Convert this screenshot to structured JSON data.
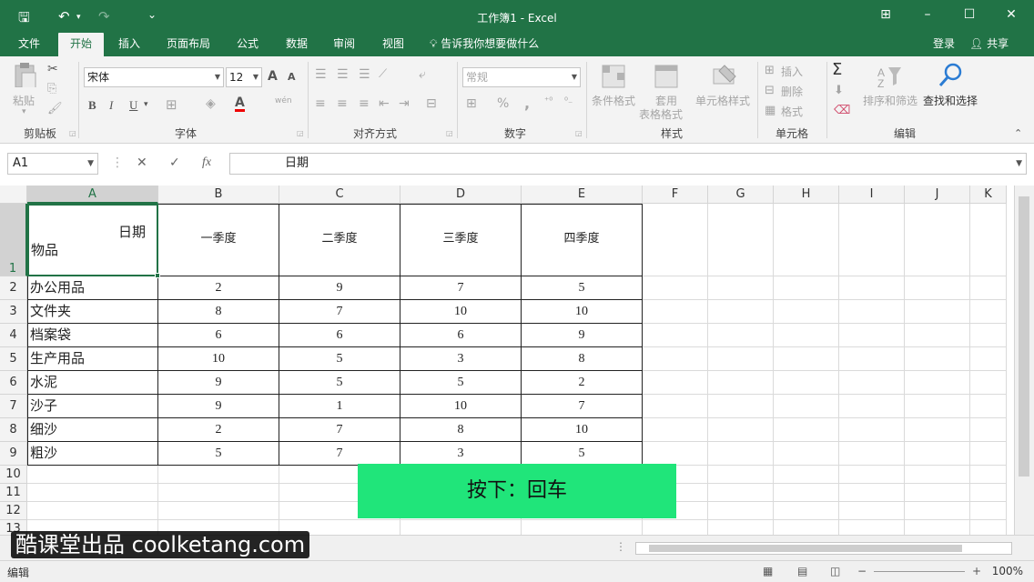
{
  "window": {
    "title": "工作簿1 - Excel",
    "min": "–",
    "max": "☐",
    "close": "✕",
    "ribbon_opts": "⊞"
  },
  "quick_access": {
    "save": "🖫",
    "undo": "↶",
    "redo": "↷",
    "more": "⌄"
  },
  "tabs": [
    "文件",
    "开始",
    "插入",
    "页面布局",
    "公式",
    "数据",
    "审阅",
    "视图"
  ],
  "active_tab": "开始",
  "tellme": "告诉我你想要做什么",
  "account": {
    "login": "登录",
    "share": "共享"
  },
  "ribbon": {
    "clipboard": {
      "paste": "粘贴",
      "label": "剪贴板"
    },
    "font": {
      "name": "宋体",
      "size": "12",
      "bold": "B",
      "italic": "I",
      "underline": "U",
      "grow": "A",
      "shrink": "A",
      "wen": "wén",
      "label": "字体"
    },
    "align": {
      "label": "对齐方式"
    },
    "number": {
      "format": "常规",
      "percent": "%",
      "comma": ",",
      "label": "数字"
    },
    "styles": {
      "conditional": "条件格式",
      "table": "套用",
      "table2": "表格格式",
      "cell_style": "单元格样式",
      "label": "样式"
    },
    "cells": {
      "insert": "插入",
      "delete": "删除",
      "format": "格式",
      "label": "单元格"
    },
    "editing": {
      "sigma": "Σ",
      "sort": "排序和筛选",
      "find": "查找和选择",
      "label": "编辑"
    }
  },
  "formula_bar": {
    "name_box": "A1",
    "cancel": "✕",
    "enter": "✓",
    "fx": "fx",
    "content": "日期"
  },
  "columns": [
    "A",
    "B",
    "C",
    "D",
    "E",
    "F",
    "G",
    "H",
    "I",
    "J",
    "K"
  ],
  "rows": [
    "1",
    "2",
    "3",
    "4",
    "5",
    "6",
    "7",
    "8",
    "9",
    "10",
    "11",
    "12",
    "13"
  ],
  "table": {
    "header_date": "日期",
    "header_item": "物品",
    "quarters": [
      "一季度",
      "二季度",
      "三季度",
      "四季度"
    ],
    "data": [
      {
        "item": "办公用品",
        "q": [
          "2",
          "9",
          "7",
          "5"
        ]
      },
      {
        "item": "文件夹",
        "q": [
          "8",
          "7",
          "10",
          "10"
        ]
      },
      {
        "item": "档案袋",
        "q": [
          "6",
          "6",
          "6",
          "9"
        ]
      },
      {
        "item": "生产用品",
        "q": [
          "10",
          "5",
          "3",
          "8"
        ]
      },
      {
        "item": "水泥",
        "q": [
          "9",
          "5",
          "5",
          "2"
        ]
      },
      {
        "item": "沙子",
        "q": [
          "9",
          "1",
          "10",
          "7"
        ]
      },
      {
        "item": "细沙",
        "q": [
          "2",
          "7",
          "8",
          "10"
        ]
      },
      {
        "item": "粗沙",
        "q": [
          "5",
          "7",
          "3",
          "5"
        ]
      }
    ]
  },
  "key_hint": "按下：回车",
  "watermark": "酷课堂出品 coolketang.com",
  "status": {
    "mode": "编辑",
    "zoom": "100%"
  },
  "colors": {
    "accent": "#217346",
    "hint": "#20e57a"
  }
}
